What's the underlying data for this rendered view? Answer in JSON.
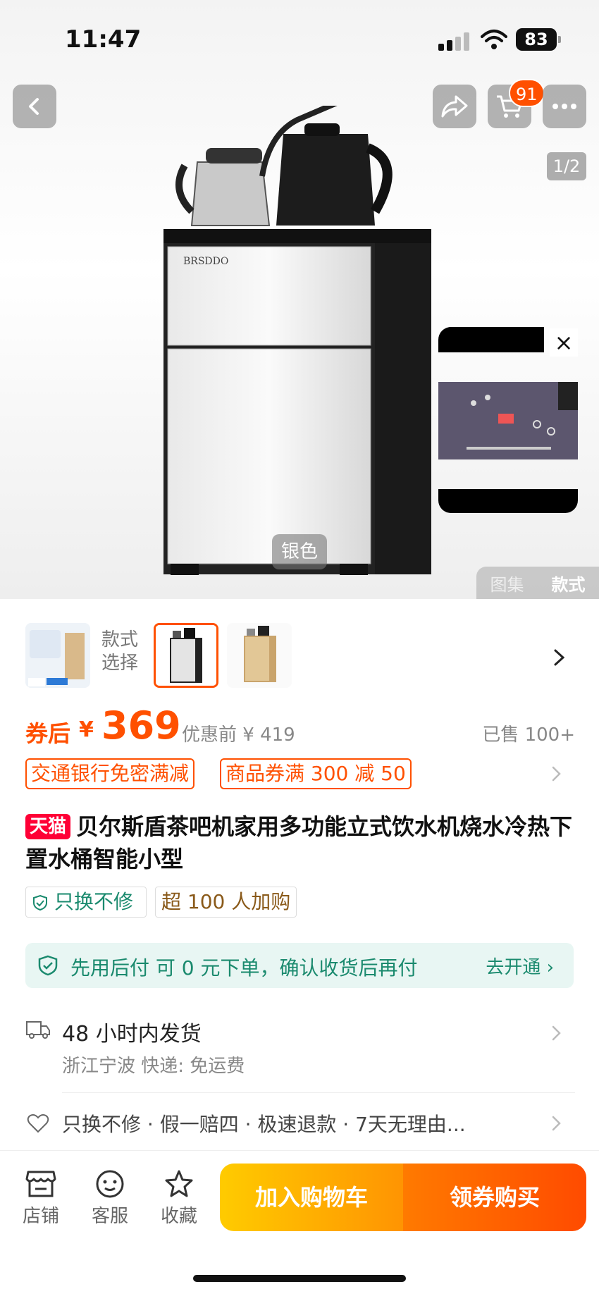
{
  "status_bar": {
    "time": "11:47",
    "battery": "83"
  },
  "nav": {
    "cart_count": "91",
    "page_indicator": "1/2"
  },
  "hero": {
    "brand_logo": "BRSDDO",
    "color_tag": "银色",
    "tabs": [
      "图集",
      "款式"
    ]
  },
  "variants": {
    "label": "款式选择",
    "label_lines": [
      "款式",
      "选择"
    ]
  },
  "price": {
    "after_label": "券后",
    "currency": "¥",
    "value": "369",
    "before": "优惠前 ¥ 419",
    "sold": "已售 100+"
  },
  "coupons": [
    "交通银行免密满减",
    "商品券满 300 减 50"
  ],
  "title": {
    "badge": "天猫",
    "text": "贝尔斯盾茶吧机家用多功能立式饮水机烧水冷热下置水桶智能小型"
  },
  "tags": [
    "只换不修",
    "超 100 人加购"
  ],
  "pay_later": {
    "text": "先用后付 可 0 元下单，确认收货后再付",
    "link": "去开通"
  },
  "shipping": {
    "main": "48 小时内发货",
    "sub": "浙江宁波  快递: 免运费"
  },
  "guarantees": {
    "text": "只换不修 · 假一赔四 · 极速退款 · 7天无理由..."
  },
  "bottom_bar": {
    "shop": "店铺",
    "service": "客服",
    "favorite": "收藏",
    "add_to_cart": "加入购物车",
    "buy_with_coupon": "领券购买"
  },
  "colors": {
    "accent": "#ff5000",
    "tmall": "#ff0036",
    "green": "#1a8a6e"
  }
}
